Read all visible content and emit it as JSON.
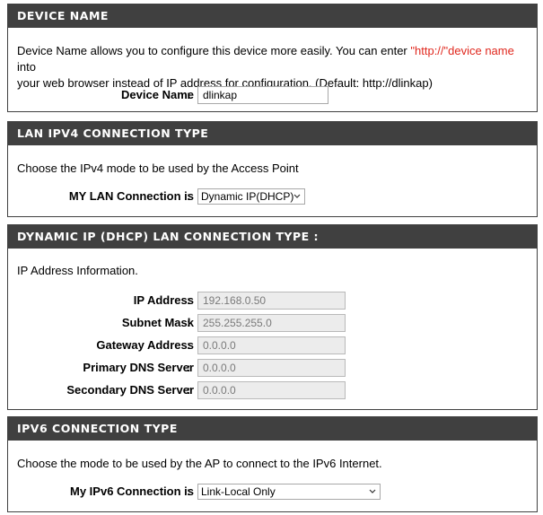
{
  "device_name_section": {
    "title": "DEVICE NAME",
    "desc_part1": "Device Name allows you to configure this device more easily. You can enter ",
    "desc_link": "\"http://\"device name",
    "desc_part2": "  into",
    "desc_line2": "your web browser instead of IP address for configuration. (Default: http://dlinkap)",
    "field_label": "Device Name",
    "field_value": "dlinkap"
  },
  "lan_ipv4_section": {
    "title": "LAN IPV4 CONNECTION TYPE",
    "desc": "Choose the IPv4 mode to be used by the Access Point",
    "field_label": "MY LAN Connection is",
    "selected": "Dynamic IP(DHCP)"
  },
  "dhcp_section": {
    "title": "DYNAMIC IP (DHCP) LAN CONNECTION TYPE :",
    "desc": "IP Address Information.",
    "fields": [
      {
        "label": "IP Address",
        "value": "192.168.0.50"
      },
      {
        "label": "Subnet Mask",
        "value": "255.255.255.0"
      },
      {
        "label": "Gateway Address",
        "value": "0.0.0.0"
      },
      {
        "label": "Primary DNS Server",
        "value": "0.0.0.0"
      },
      {
        "label": "Secondary DNS Server",
        "value": "0.0.0.0"
      }
    ]
  },
  "ipv6_section": {
    "title": "IPV6 CONNECTION TYPE",
    "desc": "Choose the mode to be used by the AP to connect to the IPv6 Internet.",
    "field_label": "My IPv6 Connection is",
    "selected": "Link-Local Only"
  },
  "separator": ":",
  "colors": {
    "header_bg": "#404040",
    "header_text": "#ffffff",
    "link_red": "#e0281e",
    "readonly_bg": "#ececec"
  },
  "icons": {
    "select_arrow": "chevron-down-icon"
  }
}
